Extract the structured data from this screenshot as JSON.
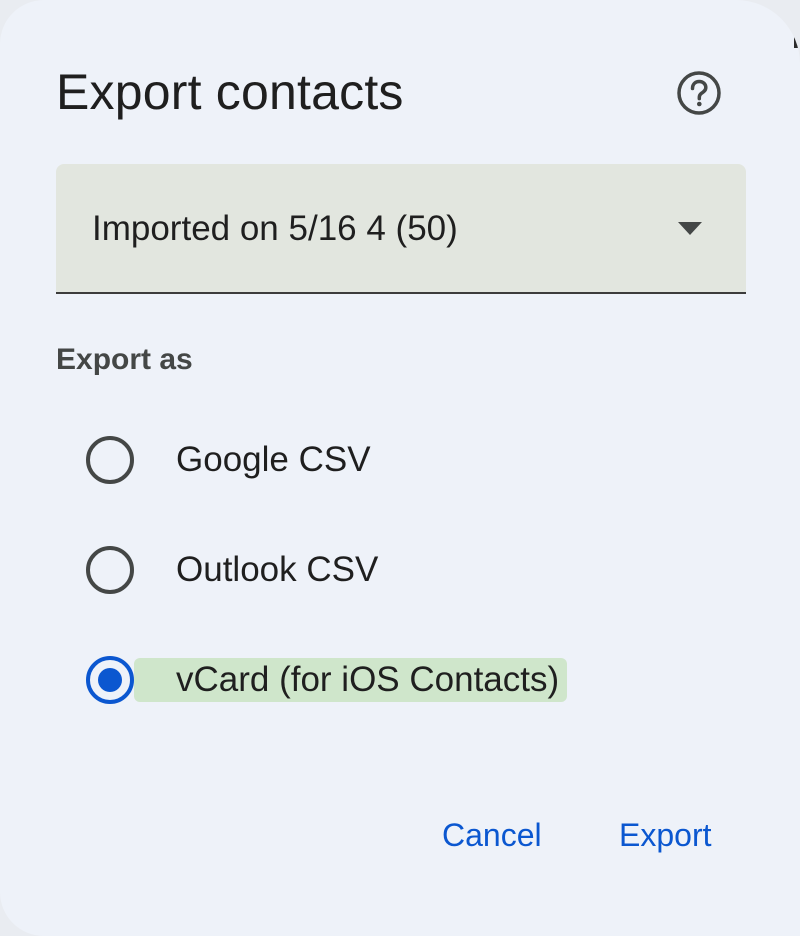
{
  "dialog": {
    "title": "Export contacts",
    "help_icon": "help-circle-icon"
  },
  "contact_select": {
    "selected_value": "Imported on 5/16 4 (50)",
    "dropdown_icon": "arrow-drop-down-icon"
  },
  "export_as": {
    "label": "Export as",
    "options": [
      {
        "label": "Google CSV",
        "checked": false
      },
      {
        "label": "Outlook CSV",
        "checked": false
      },
      {
        "label": "vCard (for iOS Contacts)",
        "checked": true
      }
    ]
  },
  "actions": {
    "cancel_label": "Cancel",
    "export_label": "Export"
  },
  "colors": {
    "accent": "#0b57d0",
    "dialog_background": "#eef2f9",
    "select_background": "#e2e6df",
    "highlight": "#cfe6cb"
  }
}
